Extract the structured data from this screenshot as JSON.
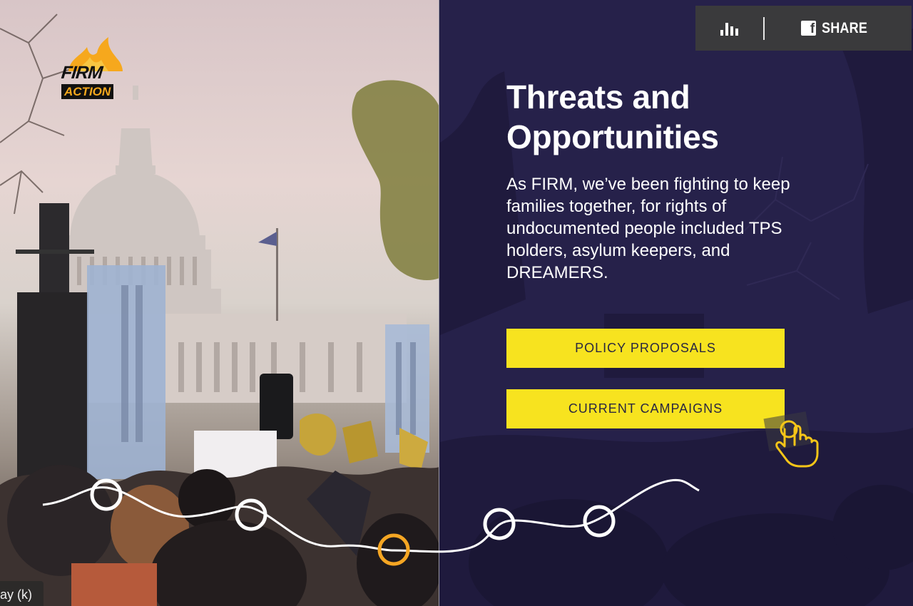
{
  "logo": {
    "line1": "FIRM",
    "line2": "ACTION"
  },
  "toolbar": {
    "share_label": "SHARE",
    "fb_glyph": "f"
  },
  "section": {
    "title": "Threats and Opportunities",
    "intro": "As FIRM, we’ve been fighting to keep families together, for rights of undocumented people included TPS holders, asylum keepers, and DREAMERS."
  },
  "buttons": {
    "policy": "POLICY PROPOSALS",
    "campaigns": "CURRENT CAMPAIGNS"
  },
  "keyboard_hint": "ay (k)",
  "timeline": {
    "active_index": 3,
    "colors": {
      "node": "#ffffff",
      "active": "#f5a623",
      "line": "#ffffff"
    }
  },
  "colors": {
    "panel_bg": "#26214a",
    "button_bg": "#f7e31f",
    "toolbar_bg": "#3a3a3c",
    "accent": "#f6a81d"
  },
  "icons": [
    "bar-chart-icon",
    "facebook-icon",
    "pointer-hand-icon",
    "firm-flame-icon"
  ]
}
